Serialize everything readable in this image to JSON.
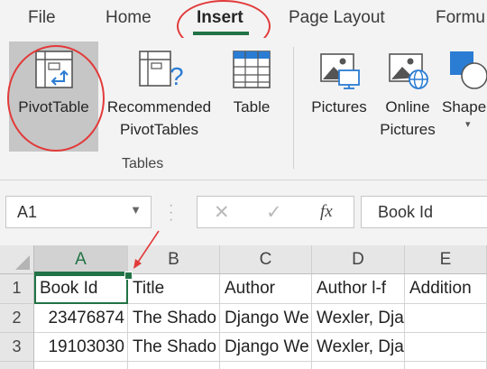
{
  "ribbon_tabs": {
    "file": "File",
    "home": "Home",
    "insert": "Insert",
    "page_layout": "Page Layout",
    "formulas": "Formu"
  },
  "ribbon": {
    "pivot_table": "PivotTable",
    "recommended_line1": "Recommended",
    "recommended_line2": "PivotTables",
    "table": "Table",
    "tables_group": "Tables",
    "pictures": "Pictures",
    "online_line1": "Online",
    "online_line2": "Pictures",
    "shapes": "Shape"
  },
  "formula_bar": {
    "name_box": "A1",
    "fx": "fx",
    "content": "Book Id"
  },
  "grid": {
    "columns": [
      "A",
      "B",
      "C",
      "D",
      "E"
    ],
    "rows": [
      "1",
      "2",
      "3"
    ],
    "cells": [
      [
        "Book Id",
        "Title",
        "Author",
        "Author l-f",
        "Addition"
      ],
      [
        "23476874",
        "The Shado",
        "Django We",
        "Wexler, Django",
        ""
      ],
      [
        "19103030",
        "The Shado",
        "Django We",
        "Wexler, Django",
        ""
      ]
    ]
  },
  "colors": {
    "accent": "#217346",
    "annotation": "#e23a3a"
  }
}
